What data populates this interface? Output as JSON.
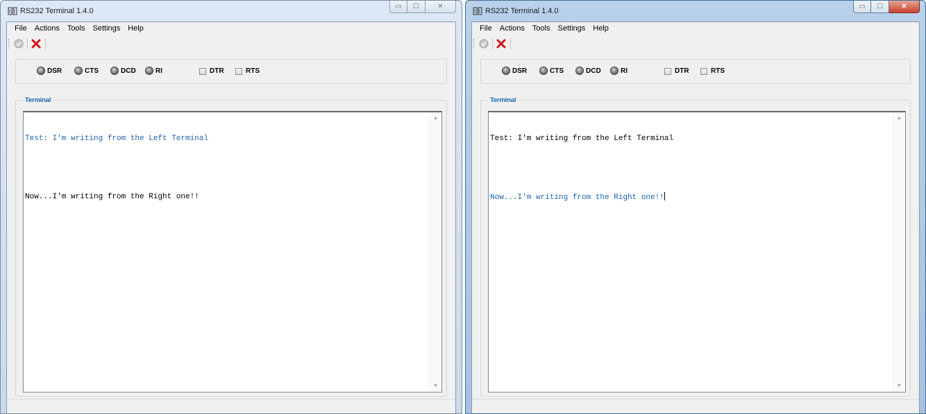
{
  "windows": [
    {
      "title": "RS232 Terminal 1.4.0",
      "menu": [
        "File",
        "Actions",
        "Tools",
        "Settings",
        "Help"
      ],
      "signals": [
        "DSR",
        "CTS",
        "DCD",
        "RI"
      ],
      "checkboxes": [
        "DTR",
        "RTS"
      ],
      "terminal_label": "Terminal",
      "lines": [
        {
          "text": "Test: I'm writing from the Left Terminal",
          "color": "#1e63ad"
        },
        {
          "text": "Now...I'm writing from the Right one!!",
          "color": "#000000"
        }
      ],
      "active": false
    },
    {
      "title": "RS232 Terminal 1.4.0",
      "menu": [
        "File",
        "Actions",
        "Tools",
        "Settings",
        "Help"
      ],
      "signals": [
        "DSR",
        "CTS",
        "DCD",
        "RI"
      ],
      "checkboxes": [
        "DTR",
        "RTS"
      ],
      "terminal_label": "Terminal",
      "lines": [
        {
          "text": "Test: I'm writing from the Left Terminal",
          "color": "#000000"
        },
        {
          "text": "Now...I'm writing from the Right one!!",
          "color": "#1e63ad"
        }
      ],
      "active": true
    }
  ],
  "icons": {
    "connect": "check-circle-icon",
    "disconnect": "red-x-icon",
    "app": "serial-port-icon"
  },
  "colors": {
    "accent_blue": "#1e63ad",
    "disconnect_red": "#d4121a"
  }
}
